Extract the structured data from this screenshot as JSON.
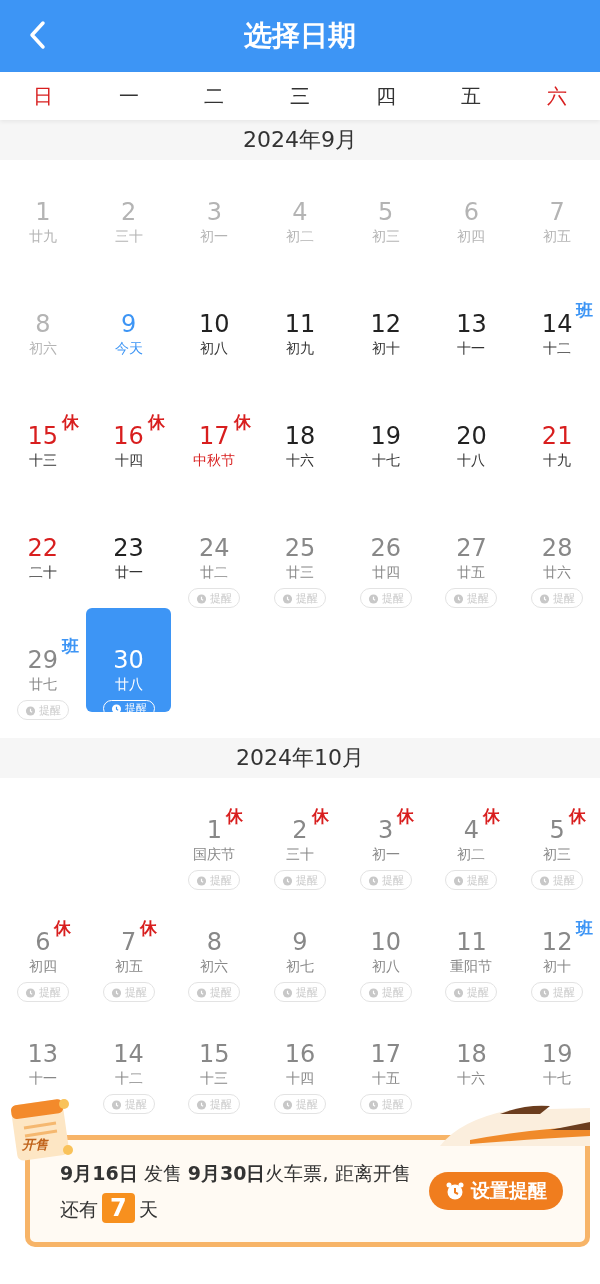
{
  "header": {
    "title": "选择日期"
  },
  "weekdays": [
    {
      "label": "日",
      "weekend": true
    },
    {
      "label": "一",
      "weekend": false
    },
    {
      "label": "二",
      "weekend": false
    },
    {
      "label": "三",
      "weekend": false
    },
    {
      "label": "四",
      "weekend": false
    },
    {
      "label": "五",
      "weekend": false
    },
    {
      "label": "六",
      "weekend": true
    }
  ],
  "months": [
    {
      "title": "2024年9月",
      "weeks": [
        [
          {
            "kind": "past",
            "day": "1",
            "lunar": "廿九",
            "selected": false
          },
          {
            "kind": "past",
            "day": "2",
            "lunar": "三十",
            "selected": false
          },
          {
            "kind": "past",
            "day": "3",
            "lunar": "初一",
            "selected": false
          },
          {
            "kind": "past",
            "day": "4",
            "lunar": "初二",
            "selected": false
          },
          {
            "kind": "past",
            "day": "5",
            "lunar": "初三",
            "selected": false
          },
          {
            "kind": "past",
            "day": "6",
            "lunar": "初四",
            "selected": false
          },
          {
            "kind": "past",
            "day": "7",
            "lunar": "初五",
            "selected": false
          }
        ],
        [
          {
            "kind": "past",
            "day": "8",
            "lunar": "初六",
            "selected": false
          },
          {
            "kind": "today",
            "day": "9",
            "lunar": "今天",
            "selected": false
          },
          {
            "kind": "open",
            "day": "10",
            "lunar": "初八",
            "selected": false
          },
          {
            "kind": "open",
            "day": "11",
            "lunar": "初九",
            "selected": false
          },
          {
            "kind": "open",
            "day": "12",
            "lunar": "初十",
            "selected": false
          },
          {
            "kind": "open",
            "day": "13",
            "lunar": "十一",
            "selected": false
          },
          {
            "kind": "open",
            "day": "14",
            "lunar": "十二",
            "selected": false,
            "tag": {
              "text": "班",
              "kind": "work"
            }
          }
        ],
        [
          {
            "kind": "holiday",
            "day": "15",
            "lunar": "十三",
            "selected": false,
            "tag": {
              "text": "休",
              "kind": "rest"
            }
          },
          {
            "kind": "holiday",
            "day": "16",
            "lunar": "十四",
            "selected": false,
            "tag": {
              "text": "休",
              "kind": "rest"
            }
          },
          {
            "kind": "holiday",
            "day": "17",
            "lunar": "中秋节",
            "lunar_red": true,
            "selected": false,
            "tag": {
              "text": "休",
              "kind": "rest"
            }
          },
          {
            "kind": "open",
            "day": "18",
            "lunar": "十六",
            "selected": false
          },
          {
            "kind": "open",
            "day": "19",
            "lunar": "十七",
            "selected": false
          },
          {
            "kind": "open",
            "day": "20",
            "lunar": "十八",
            "selected": false
          },
          {
            "kind": "holiday",
            "day": "21",
            "lunar": "十九",
            "selected": false
          }
        ],
        [
          {
            "kind": "holiday",
            "day": "22",
            "lunar": "二十",
            "selected": false
          },
          {
            "kind": "open",
            "day": "23",
            "lunar": "廿一",
            "selected": false
          },
          {
            "kind": "presale",
            "day": "24",
            "lunar": "廿二",
            "selected": false,
            "reminder": "提醒"
          },
          {
            "kind": "presale",
            "day": "25",
            "lunar": "廿三",
            "selected": false,
            "reminder": "提醒"
          },
          {
            "kind": "presale",
            "day": "26",
            "lunar": "廿四",
            "selected": false,
            "reminder": "提醒"
          },
          {
            "kind": "presale",
            "day": "27",
            "lunar": "廿五",
            "selected": false,
            "reminder": "提醒"
          },
          {
            "kind": "presale",
            "day": "28",
            "lunar": "廿六",
            "selected": false,
            "reminder": "提醒"
          }
        ],
        [
          {
            "kind": "presale",
            "day": "29",
            "lunar": "廿七",
            "selected": false,
            "reminder": "提醒",
            "tag": {
              "text": "班",
              "kind": "work"
            }
          },
          {
            "kind": "presale",
            "day": "30",
            "lunar": "廿八",
            "selected": true,
            "reminder": "提醒"
          },
          {
            "kind": "empty"
          },
          {
            "kind": "empty"
          },
          {
            "kind": "empty"
          },
          {
            "kind": "empty"
          },
          {
            "kind": "empty"
          }
        ]
      ]
    },
    {
      "title": "2024年10月",
      "weeks": [
        [
          {
            "kind": "empty"
          },
          {
            "kind": "empty"
          },
          {
            "kind": "presale",
            "day": "1",
            "lunar": "国庆节",
            "selected": false,
            "reminder": "提醒",
            "tag": {
              "text": "休",
              "kind": "rest"
            }
          },
          {
            "kind": "presale",
            "day": "2",
            "lunar": "三十",
            "selected": false,
            "reminder": "提醒",
            "tag": {
              "text": "休",
              "kind": "rest"
            }
          },
          {
            "kind": "presale",
            "day": "3",
            "lunar": "初一",
            "selected": false,
            "reminder": "提醒",
            "tag": {
              "text": "休",
              "kind": "rest"
            }
          },
          {
            "kind": "presale",
            "day": "4",
            "lunar": "初二",
            "selected": false,
            "reminder": "提醒",
            "tag": {
              "text": "休",
              "kind": "rest"
            }
          },
          {
            "kind": "presale",
            "day": "5",
            "lunar": "初三",
            "selected": false,
            "reminder": "提醒",
            "tag": {
              "text": "休",
              "kind": "rest"
            }
          }
        ],
        [
          {
            "kind": "presale",
            "day": "6",
            "lunar": "初四",
            "selected": false,
            "reminder": "提醒",
            "tag": {
              "text": "休",
              "kind": "rest"
            }
          },
          {
            "kind": "presale",
            "day": "7",
            "lunar": "初五",
            "selected": false,
            "reminder": "提醒",
            "tag": {
              "text": "休",
              "kind": "rest"
            }
          },
          {
            "kind": "presale",
            "day": "8",
            "lunar": "初六",
            "selected": false,
            "reminder": "提醒"
          },
          {
            "kind": "presale",
            "day": "9",
            "lunar": "初七",
            "selected": false,
            "reminder": "提醒"
          },
          {
            "kind": "presale",
            "day": "10",
            "lunar": "初八",
            "selected": false,
            "reminder": "提醒"
          },
          {
            "kind": "presale",
            "day": "11",
            "lunar": "重阳节",
            "selected": false,
            "reminder": "提醒"
          },
          {
            "kind": "presale",
            "day": "12",
            "lunar": "初十",
            "selected": false,
            "reminder": "提醒",
            "tag": {
              "text": "班",
              "kind": "work"
            }
          }
        ],
        [
          {
            "kind": "presale",
            "day": "13",
            "lunar": "十一",
            "selected": false
          },
          {
            "kind": "presale",
            "day": "14",
            "lunar": "十二",
            "selected": false,
            "reminder": "提醒"
          },
          {
            "kind": "presale",
            "day": "15",
            "lunar": "十三",
            "selected": false,
            "reminder": "提醒"
          },
          {
            "kind": "presale",
            "day": "16",
            "lunar": "十四",
            "selected": false,
            "reminder": "提醒"
          },
          {
            "kind": "presale",
            "day": "17",
            "lunar": "十五",
            "selected": false,
            "reminder": "提醒"
          },
          {
            "kind": "presale",
            "day": "18",
            "lunar": "十六",
            "selected": false
          },
          {
            "kind": "presale",
            "day": "19",
            "lunar": "十七",
            "selected": false
          }
        ]
      ]
    }
  ],
  "sale_banner": {
    "sticker_label": "开售",
    "message": "**9月16日** 发售 **9月30日**火车票, 距离开售还有",
    "days": "7",
    "unit": "天",
    "button": "设置提醒"
  }
}
